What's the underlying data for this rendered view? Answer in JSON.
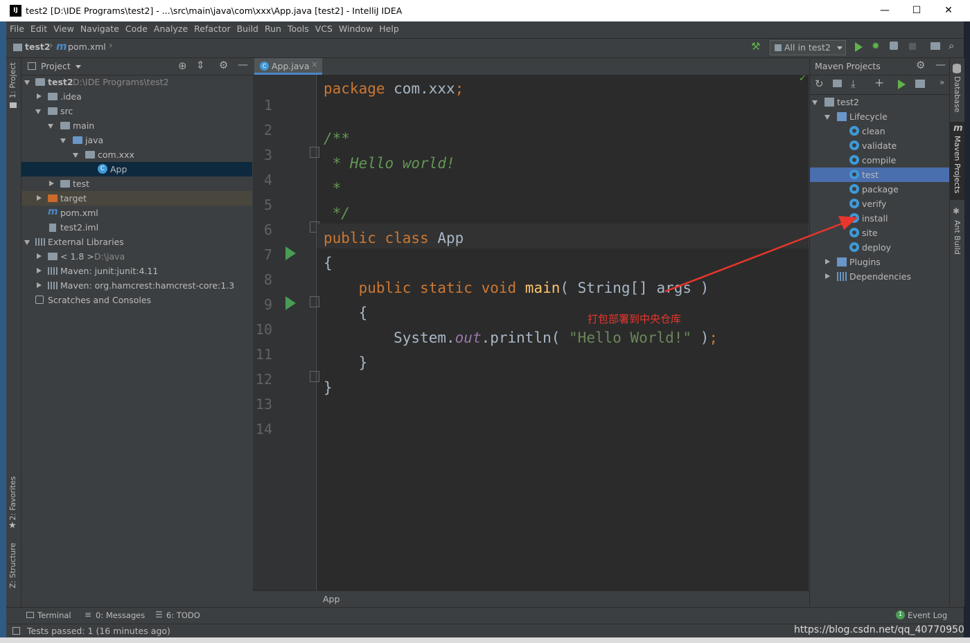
{
  "window": {
    "title": "test2 [D:\\IDE Programs\\test2] - ...\\src\\main\\java\\com\\xxx\\App.java [test2] - IntelliJ IDEA",
    "logo": "IJ",
    "min": "—",
    "max": "☐",
    "close": "✕"
  },
  "menu": [
    "File",
    "Edit",
    "View",
    "Navigate",
    "Code",
    "Analyze",
    "Refactor",
    "Build",
    "Run",
    "Tools",
    "VCS",
    "Window",
    "Help"
  ],
  "nav": {
    "project": "test2",
    "file": "pom.xml",
    "run_config": "All in test2"
  },
  "left_stripe": {
    "project": "1: Project",
    "favorites": "2: Favorites",
    "structure": "Z: Structure"
  },
  "project_panel": {
    "header": "Project",
    "tree": [
      {
        "label": "test2",
        "extra": "D:\\IDE Programs\\test2"
      },
      {
        "label": ".idea"
      },
      {
        "label": "src"
      },
      {
        "label": "main"
      },
      {
        "label": "java"
      },
      {
        "label": "com.xxx"
      },
      {
        "label": "App"
      },
      {
        "label": "test"
      },
      {
        "label": "target"
      },
      {
        "label": "pom.xml"
      },
      {
        "label": "test2.iml"
      },
      {
        "label": "External Libraries"
      },
      {
        "label": "< 1.8 >",
        "extra": "D:\\java"
      },
      {
        "label": "Maven: junit:junit:4.11"
      },
      {
        "label": "Maven: org.hamcrest:hamcrest-core:1.3"
      },
      {
        "label": "Scratches and Consoles"
      }
    ]
  },
  "editor": {
    "tab": "App.java",
    "line_numbers": [
      "1",
      "2",
      "3",
      "4",
      "5",
      "6",
      "7",
      "8",
      "9",
      "10",
      "11",
      "12",
      "13",
      "14"
    ],
    "code": {
      "l1_kw": "package",
      "l1_rest": " com.xxx",
      "l1_semi": ";",
      "l3": "/**",
      "l4": " * Hello world!",
      "l5": " *",
      "l6": " */",
      "l7_kw": "public class",
      "l7_rest": " App",
      "l8": "{",
      "l9_kw": "    public static void",
      "l9_fn": " main",
      "l9_rest": "( String[] args )",
      "l10": "    {",
      "l11_a": "        System.",
      "l11_fld": "out",
      "l11_b": ".println( ",
      "l11_str": "\"Hello World!\"",
      "l11_c": " )",
      "l11_semi": ";",
      "l12": "    }",
      "l13": "}"
    },
    "breadcrumb": "App"
  },
  "maven": {
    "title": "Maven Projects",
    "root": "test2",
    "lifecycle": "Lifecycle",
    "goals": [
      "clean",
      "validate",
      "compile",
      "test",
      "package",
      "verify",
      "install",
      "site",
      "deploy"
    ],
    "selected_goal": "test",
    "plugins": "Plugins",
    "dependencies": "Dependencies"
  },
  "right_stripe": {
    "database": "Database",
    "maven": "Maven Projects",
    "ant": "Ant Build"
  },
  "annotation": {
    "text": "打包部署到中央仓库",
    "color": "#e8362c"
  },
  "bottom_tools": {
    "terminal": "Terminal",
    "messages": "0: Messages",
    "todo": "6: TODO",
    "event_log": "Event Log",
    "event_count": "1"
  },
  "status": {
    "text": "Tests passed: 1 (16 minutes ago)",
    "watermark": "https://blog.csdn.net/qq_40770950"
  }
}
